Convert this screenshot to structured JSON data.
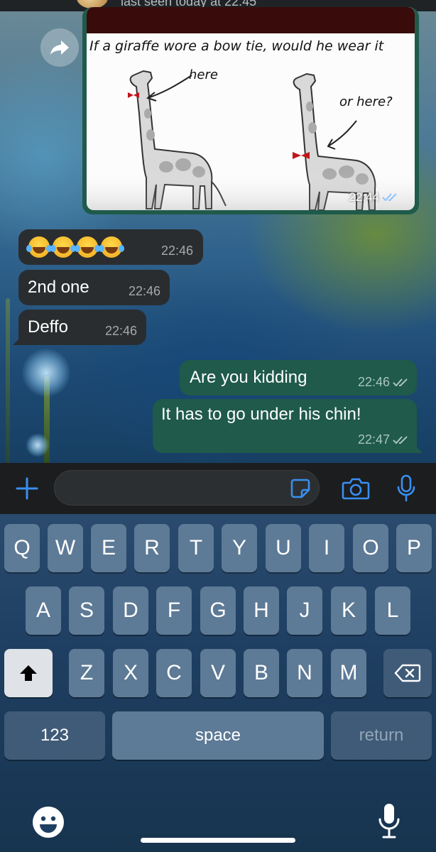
{
  "header": {
    "status": "last seen today at 22:45"
  },
  "image_message": {
    "caption": "If a giraffe wore a bow tie, would he wear it",
    "label_left": "here",
    "label_right": "or here?",
    "time": "22:44"
  },
  "messages": [
    {
      "direction": "incoming",
      "emoji_count": 4,
      "time": "22:46"
    },
    {
      "direction": "incoming",
      "text": "2nd one",
      "time": "22:46"
    },
    {
      "direction": "incoming",
      "text": "Deffo",
      "time": "22:46"
    },
    {
      "direction": "outgoing",
      "text": "Are you kidding",
      "time": "22:46"
    },
    {
      "direction": "outgoing",
      "text": "It has to go under his chin!",
      "time": "22:47"
    }
  ],
  "input": {
    "placeholder": ""
  },
  "keyboard": {
    "row1": [
      "Q",
      "W",
      "E",
      "R",
      "T",
      "Y",
      "U",
      "I",
      "O",
      "P"
    ],
    "row2": [
      "A",
      "S",
      "D",
      "F",
      "G",
      "H",
      "J",
      "K",
      "L"
    ],
    "row3": [
      "Z",
      "X",
      "C",
      "V",
      "B",
      "N",
      "M"
    ],
    "numbers_label": "123",
    "space_label": "space",
    "return_label": "return"
  },
  "colors": {
    "incoming_bubble": "#2a2d2f",
    "outgoing_bubble": "#1f5a4a",
    "accent": "#3a8ff0"
  },
  "icons": [
    "forward-icon",
    "read-receipt-icon",
    "plus-icon",
    "sticker-icon",
    "camera-icon",
    "microphone-icon",
    "shift-icon",
    "backspace-icon",
    "emoji-icon",
    "dictation-icon"
  ]
}
